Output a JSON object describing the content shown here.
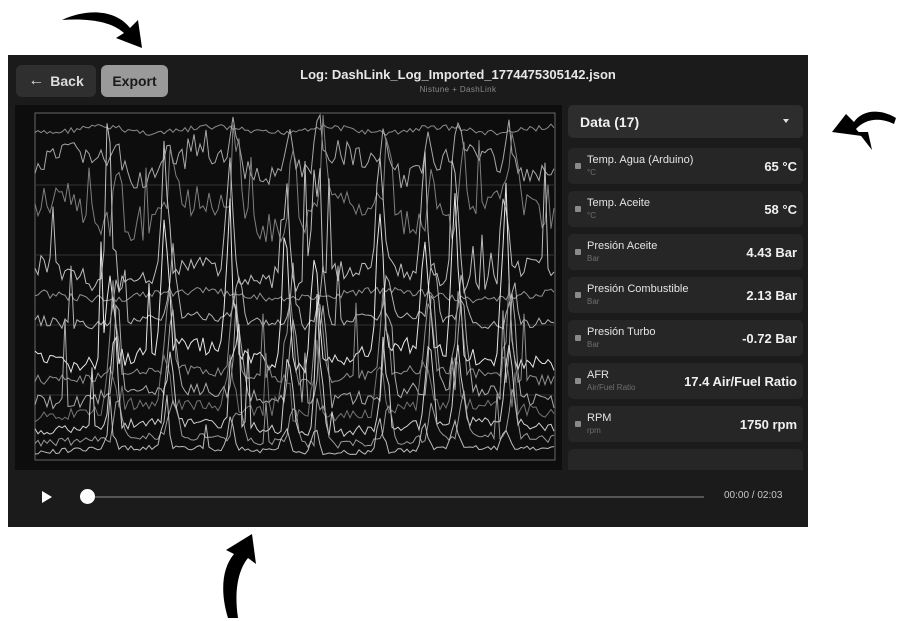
{
  "header": {
    "back_label": "Back",
    "export_label": "Export",
    "title": "Log: DashLink_Log_Imported_1774475305142.json",
    "subtitle": "Nistune + DashLink"
  },
  "panel": {
    "dropdown_label": "Data (17)",
    "items": [
      {
        "name": "Temp. Agua (Arduino)",
        "unit": "°C",
        "value": "65 °C"
      },
      {
        "name": "Temp. Aceite",
        "unit": "°C",
        "value": "58 °C"
      },
      {
        "name": "Presión Aceite",
        "unit": "Bar",
        "value": "4.43 Bar"
      },
      {
        "name": "Presión Combustible",
        "unit": "Bar",
        "value": "2.13 Bar"
      },
      {
        "name": "Presión Turbo",
        "unit": "Bar",
        "value": "-0.72 Bar"
      },
      {
        "name": "AFR",
        "unit": "Air/Fuel Ratio",
        "value": "17.4 Air/Fuel Ratio"
      },
      {
        "name": "RPM",
        "unit": "rpm",
        "value": "1750 rpm"
      }
    ]
  },
  "player": {
    "time": "00:00 / 02:03",
    "progress": 0
  },
  "colors": {
    "app_bg": "#1b1b1b",
    "chart_bg": "#0d0d0d",
    "line": "#cfcfcf",
    "accent_button": "#9a9a9a"
  }
}
